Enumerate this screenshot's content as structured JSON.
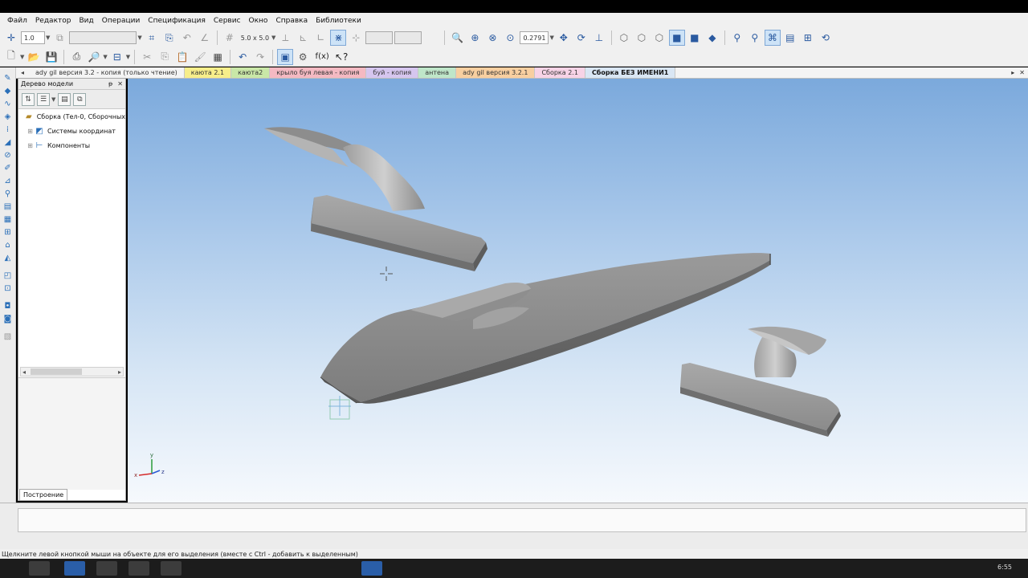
{
  "menu": [
    "Файл",
    "Редактор",
    "Вид",
    "Операции",
    "Спецификация",
    "Сервис",
    "Окно",
    "Справка",
    "Библиотеки"
  ],
  "toolbar1": {
    "step_value": "1.0",
    "grid_value": "5.0 x 5.0",
    "zoom_value": "0.2791"
  },
  "toolbar2": {
    "fx_label": "f(x)"
  },
  "doc_tabs": [
    {
      "label": "ady gil версия 3.2 - копия (только чтение)",
      "color": "#f4f4f4"
    },
    {
      "label": "каюта 2.1",
      "color": "#f7ee8a"
    },
    {
      "label": "каюта2",
      "color": "#c9e7a7"
    },
    {
      "label": "крыло буя левая - копия",
      "color": "#f4b9c2"
    },
    {
      "label": "буй - копия",
      "color": "#d6c6ef"
    },
    {
      "label": "антена",
      "color": "#bfe6c9"
    },
    {
      "label": "ady gil версия 3.2.1",
      "color": "#f8cfa0"
    },
    {
      "label": "Сборка 2.1",
      "color": "#f7d3e6"
    },
    {
      "label": "Сборка БЕЗ ИМЕНИ1",
      "color": "#d9e6f4"
    }
  ],
  "tree": {
    "title": "Дерево модели",
    "root": "Сборка (Тел-0, Сборочных",
    "items": [
      "Системы координат",
      "Компоненты"
    ],
    "footer_tab": "Построение"
  },
  "status_text": "Щелкните левой кнопкой мыши на объекте для его выделения (вместе с Ctrl - добавить к выделенным)",
  "axis_labels": {
    "x": "x",
    "y": "y",
    "z": "z"
  },
  "clock": "6:55"
}
